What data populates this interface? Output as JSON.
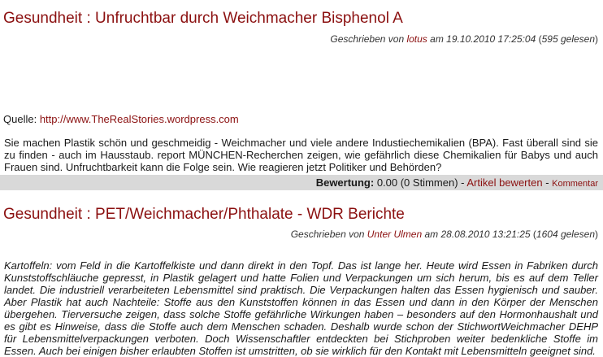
{
  "articles": [
    {
      "category": "Gesundheit",
      "separator": " : ",
      "title": "Unfruchtbar durch Weichmacher Bisphenol A",
      "meta": {
        "prefix": "Geschrieben von ",
        "author": "lotus",
        "date_prefix": " am ",
        "date": "19.10.2010 17:25:04",
        "reads_open": " (",
        "reads": "595 gelesen",
        "reads_close": ")"
      },
      "source_label": "Quelle: ",
      "source_url": "http://www.TheRealStories.wordpress.com",
      "body": "Sie machen Plastik schön und geschmeidig - Weichmacher und viele andere Industiechemikalien (BPA). Fast überall sind sie zu finden - auch im Hausstaub. report MÜNCHEN-Recherchen zeigen, wie gefährlich diese Chemikalien für Babys und auch Frauen sind. Unfruchtbarkeit kann die Folge sein. Wie reagieren jetzt Politiker und Behörden?",
      "rating": {
        "label": "Bewertung:",
        "value": " 0.00 (0 Stimmen) - ",
        "rate_link": "Artikel bewerten",
        "sep": " - ",
        "comment_link": "Kommentar"
      }
    },
    {
      "category": "Gesundheit",
      "separator": " : ",
      "title": "PET/Weichmacher/Phthalate - WDR Berichte",
      "meta": {
        "prefix": "Geschrieben von ",
        "author": "Unter Ulmen",
        "date_prefix": " am ",
        "date": "28.08.2010 13:21:25",
        "reads_open": " (",
        "reads": "1604 gelesen",
        "reads_close": ")"
      },
      "body": "Kartoffeln: vom Feld in die Kartoffelkiste und dann direkt in den Topf. Das ist lange her. Heute wird Essen in Fabriken durch Kunststoffschläuche gepresst, in Plastik gelagert und hatte Folien und Verpackungen um sich herum, bis es auf dem Teller landet. Die industriell verarbeiteten Lebensmittel sind praktisch. Die Verpackungen halten das Essen hygienisch und sauber. Aber Plastik hat auch Nachteile: Stoffe aus den Kunststoffen können in das Essen und dann in den Körper der Menschen übergehen. Tierversuche zeigen, dass solche Stoffe gefährliche Wirkungen haben – besonders auf den Hormonhaushalt und es gibt es Hinweise, dass die Stoffe auch dem Menschen schaden. Deshalb wurde schon der StichwortWeichmacher DEHP für Lebensmittelverpackungen verboten. Doch Wissenschaftler entdeckten bei Stichproben weiter bedenkliche Stoffe im Essen. Auch bei einigen bisher erlaubten Stoffen ist umstritten, ob sie wirklich für den Kontakt mit Lebensmitteln geeignet sind."
    }
  ]
}
